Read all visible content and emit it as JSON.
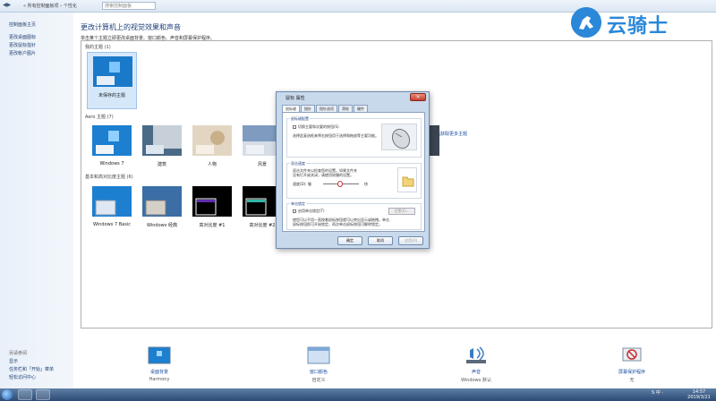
{
  "addressbar": {
    "crumbs": "« 所有控制面板项 › 个性化",
    "search_placeholder": "搜索控制面板"
  },
  "leftpane": {
    "items": [
      "控制面板主页",
      "更改桌面图标",
      "更改鼠标指针",
      "更改帐户图片"
    ],
    "see_also_title": "另请参阅",
    "see_also": [
      "显示",
      "任务栏和「开始」菜单",
      "轻松访问中心"
    ]
  },
  "main": {
    "heading": "更改计算机上的视觉效果和声音",
    "subheading": "单击某个主题立即更改桌面背景、窗口颜色、声音和屏幕保护程序。",
    "my_themes_label": "我的主题 (1)",
    "get_more": "联机获取更多主题",
    "aero_label": "Aero 主题 (7)",
    "basic_label": "基本和高对比度主题 (6)",
    "my_themes": [
      {
        "label": "未保存的主题"
      }
    ],
    "aero_themes": [
      {
        "label": "Windows 7"
      },
      {
        "label": "建筑"
      },
      {
        "label": "人物"
      },
      {
        "label": "风景"
      }
    ],
    "basic_themes": [
      {
        "label": "Windows 7 Basic"
      },
      {
        "label": "Windows 经典"
      },
      {
        "label": "高对比度 #1"
      },
      {
        "label": "高对比度 #2"
      }
    ]
  },
  "bottombar": {
    "items": [
      {
        "title": "桌面背景",
        "value": "Harmony",
        "icon": "desktop-background-icon"
      },
      {
        "title": "窗口颜色",
        "value": "自定义",
        "icon": "window-color-icon"
      },
      {
        "title": "声音",
        "value": "Windows 默认",
        "icon": "sound-icon"
      },
      {
        "title": "屏幕保护程序",
        "value": "无",
        "icon": "screensaver-icon"
      }
    ]
  },
  "dialog": {
    "title": "鼠标 属性",
    "tabs": [
      "鼠标键",
      "指针",
      "指针选项",
      "滑轮",
      "硬件"
    ],
    "active_tab": 0,
    "button_config": {
      "title": "鼠标键配置",
      "checkbox": "切换主要和次要的按钮(S)",
      "desc": [
        "选择此复选框来将右按钮用于选择和拖放等主要功能。"
      ]
    },
    "double_click": {
      "title": "双击速度",
      "desc": [
        "双击文件夹以检查您的设置。如果文件夹",
        "没有打开或关闭，请使用较慢的设置。"
      ],
      "speed_label": "速度(D): 慢",
      "fast_label": "快"
    },
    "click_lock": {
      "title": "单击锁定",
      "checkbox": "启用单击锁定(T)",
      "settings_button": "设置(E)...",
      "desc": [
        "使您可以不用一直按着鼠标按钮就可以突出显示或拖拽。单击",
        "鼠标按钮即可开始锁定，再次单击鼠标按钮可解除锁定。"
      ]
    },
    "buttons": {
      "ok": "确定",
      "cancel": "取消",
      "apply": "应用(A)"
    }
  },
  "taskbar": {
    "tray_text": "S 中 ·",
    "time": "14:57",
    "date": "2019/3/21"
  },
  "logo": {
    "text": "云骑士"
  },
  "colors": {
    "accent": "#2b88d8",
    "link": "#1a4fa0",
    "heading": "#1e3f7a",
    "taskbar": "#3b5a84"
  }
}
